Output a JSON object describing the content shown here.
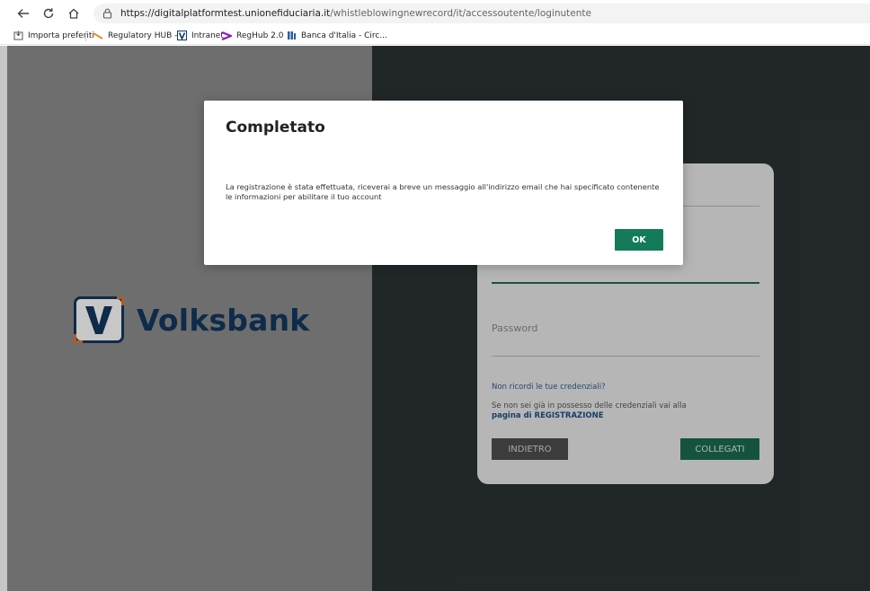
{
  "browser": {
    "url_host": "https://digitalplatformtest.unionefiduciaria.it",
    "url_path": "/whistleblowingnewrecord/it/accessoutente/loginutente",
    "favorites": {
      "import": "Importa preferiti",
      "regulatory": "Regulatory HUB -...",
      "intranet": "Intranet",
      "reghub": "RegHub 2.0",
      "banca": "Banca d'Italia - Circ..."
    }
  },
  "brand": {
    "name": "Volksbank",
    "logo_letter": "V",
    "color_dark": "#12385f",
    "color_accent": "#e2772e"
  },
  "login": {
    "password_label": "Password",
    "forgot_link": "Non ricordi le tue credenziali?",
    "info_text": "Se non sei già in possesso delle credenziali vai alla",
    "register_link": "pagina di REGISTRAZIONE",
    "back_button": "INDIETRO",
    "login_button": "COLLEGATI"
  },
  "modal": {
    "title": "Completato",
    "message": "La registrazione è stata effettuata, riceverai a breve un messaggio all'indirizzo email che hai specificato contenente le informazioni per abilitare il tuo account",
    "ok_button": "OK"
  }
}
